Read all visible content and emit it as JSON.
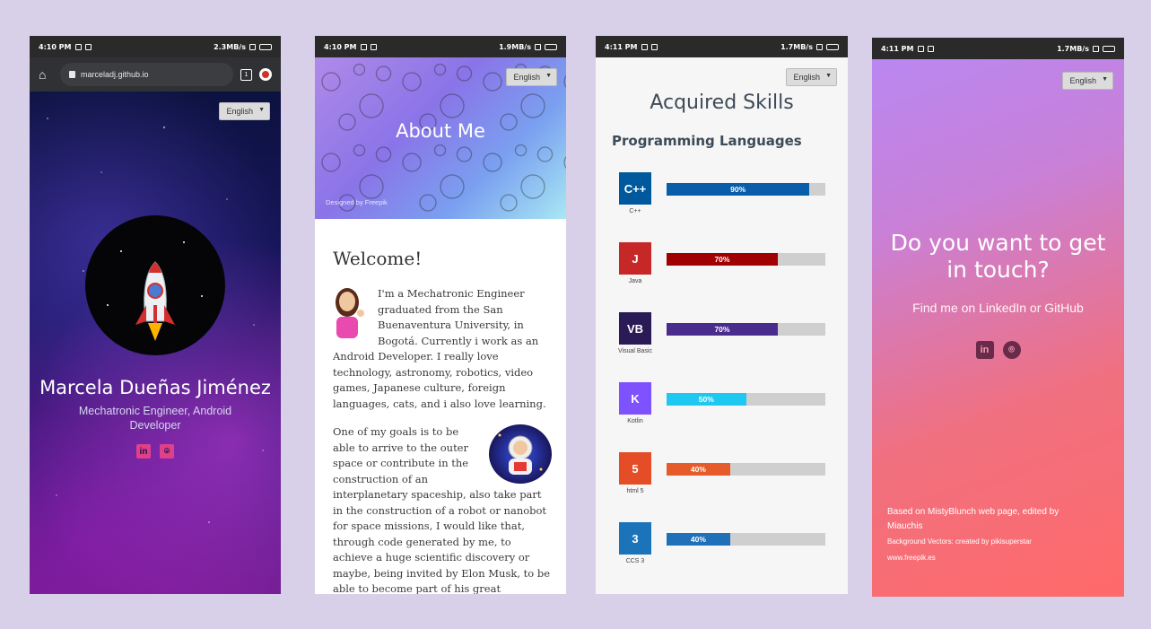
{
  "status": {
    "p1": {
      "time": "4:10 PM",
      "speed": "2.3MB/s"
    },
    "p2": {
      "time": "4:10 PM",
      "speed": "1.9MB/s"
    },
    "p3": {
      "time": "4:11 PM",
      "speed": "1.7MB/s"
    },
    "p4": {
      "time": "4:11 PM",
      "speed": "1.7MB/s"
    }
  },
  "browser": {
    "url": "marceladj.github.io",
    "tab_count": "1"
  },
  "language_select": {
    "value": "English"
  },
  "home": {
    "name": "Marcela Dueñas Jiménez",
    "subtitle": "Mechatronic Engineer, Android Developer",
    "social": [
      "linkedin-icon",
      "github-icon"
    ]
  },
  "about": {
    "title": "About Me",
    "credit": "Designed by Freepik",
    "welcome": "Welcome!",
    "para1": "I'm a Mechatronic Engineer graduated from the San Buenaventura University, in Bogotá. Currently i work as an Android Developer. I really love technology, astronomy, robotics, video games, Japanese culture, foreign languages, cats, and i also love learning.",
    "para2": "One of my goals is to be able to arrive to the outer space or contribute in the construction of an interplanetary spaceship, also take part in the construction of a robot or nanobot for space missions, I would like that, through code generated by me, to achieve a huge scientific discovery or maybe, being invited by Elon Musk, to be able to become part of his great"
  },
  "skills": {
    "title": "Acquired Skills",
    "section": "Programming Languages",
    "items": [
      {
        "name": "C++",
        "percent": 90,
        "label": "90%",
        "color": "#0a5da8",
        "logo_bg": "#00599c",
        "logo_text": "C++"
      },
      {
        "name": "Java",
        "percent": 70,
        "label": "70%",
        "color": "#a00000",
        "logo_bg": "#c62828",
        "logo_text": "J"
      },
      {
        "name": "Visual Basic",
        "percent": 70,
        "label": "70%",
        "color": "#4a2c8c",
        "logo_bg": "#2a1a55",
        "logo_text": "VB"
      },
      {
        "name": "Kotlin",
        "percent": 50,
        "label": "50%",
        "color": "#1ec8f0",
        "logo_bg": "#7f52ff",
        "logo_text": "K"
      },
      {
        "name": "html 5",
        "percent": 40,
        "label": "40%",
        "color": "#e55b2a",
        "logo_bg": "#e44d26",
        "logo_text": "5"
      },
      {
        "name": "CCS 3",
        "percent": 40,
        "label": "40%",
        "color": "#1f70b8",
        "logo_bg": "#1b73ba",
        "logo_text": "3"
      }
    ]
  },
  "contact": {
    "title": "Do you want to get in touch?",
    "subtitle": "Find me on LinkedIn or GitHub",
    "footer1": "Based on MistyBlunch web page, edited by Miauchis",
    "footer2": "Background Vectors: created by pikisuperstar",
    "footer3": "www.freepik.es"
  }
}
